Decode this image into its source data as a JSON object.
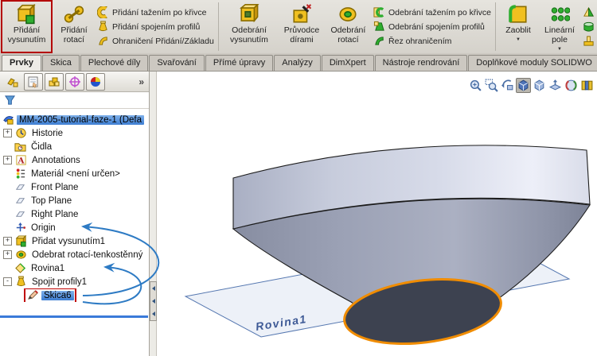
{
  "ribbon": {
    "caret_glyph": "▼",
    "groups": [
      {
        "large_buttons": [
          {
            "label": "Přidání vysunutím",
            "icon": "boss-extrude-icon",
            "highlighted": true
          },
          {
            "label": "Přidání rotací",
            "icon": "revolved-boss-icon"
          }
        ],
        "small_items": [
          {
            "label": "Přidání tažením po křivce",
            "icon": "swept-boss-icon"
          },
          {
            "label": "Přidání spojením profilů",
            "icon": "lofted-boss-icon"
          },
          {
            "label": "Ohraničení Přidání/Základu",
            "icon": "boundary-boss-icon"
          }
        ]
      },
      {
        "large_buttons": [
          {
            "label": "Odebrání vysunutím",
            "icon": "extruded-cut-icon"
          },
          {
            "label": "Průvodce dírami",
            "icon": "hole-wizard-icon"
          },
          {
            "label": "Odebrání rotací",
            "icon": "revolved-cut-icon"
          }
        ],
        "small_items": [
          {
            "label": "Odebrání tažením po křivce",
            "icon": "swept-cut-icon"
          },
          {
            "label": "Odebrání spojením profilů",
            "icon": "lofted-cut-icon"
          },
          {
            "label": "Řez ohraničením",
            "icon": "boundary-cut-icon"
          }
        ]
      },
      {
        "large_buttons": [
          {
            "label": "Zaoblit",
            "icon": "fillet-icon",
            "dropdown": true
          },
          {
            "label": "Lineární pole",
            "icon": "linear-pattern-icon",
            "dropdown": true
          }
        ],
        "small_items": [
          {
            "label": "",
            "icon": "draft-icon"
          },
          {
            "label": "",
            "icon": "shell-icon"
          },
          {
            "label": "",
            "icon": "rib-icon"
          }
        ]
      }
    ]
  },
  "tabs": {
    "items": [
      {
        "label": "Prvky",
        "active": true
      },
      {
        "label": "Skica"
      },
      {
        "label": "Plechové díly"
      },
      {
        "label": "Svařování"
      },
      {
        "label": "Přímé úpravy"
      },
      {
        "label": "Analýzy"
      },
      {
        "label": "DimXpert"
      },
      {
        "label": "Nástroje rendrování"
      },
      {
        "label": "Doplňkové moduly SOLIDWO"
      }
    ]
  },
  "feature_panel": {
    "toolbar": [
      {
        "icon": "feature-tree-icon"
      },
      {
        "icon": "property-manager-icon"
      },
      {
        "icon": "configuration-manager-icon"
      },
      {
        "icon": "dimxpert-manager-icon"
      },
      {
        "icon": "display-manager-icon"
      }
    ],
    "overflow_label": "»",
    "filter_icon": "filter-funnel-icon",
    "tree": [
      {
        "label": "MM-2005-tutorial-faze-1  (Defa",
        "icon": "part-icon",
        "level": 0,
        "selected": true
      },
      {
        "label": "Historie",
        "icon": "history-icon",
        "level": 1,
        "expander": "+"
      },
      {
        "label": "Čidla",
        "icon": "sensors-icon",
        "level": 1
      },
      {
        "label": "Annotations",
        "icon": "annotations-icon",
        "level": 1,
        "expander": "+"
      },
      {
        "label": "Materiál <není určen>",
        "icon": "material-icon",
        "level": 1
      },
      {
        "label": "Front Plane",
        "icon": "plane-icon",
        "level": 1
      },
      {
        "label": "Top Plane",
        "icon": "plane-icon",
        "level": 1
      },
      {
        "label": "Right Plane",
        "icon": "plane-icon",
        "level": 1
      },
      {
        "label": "Origin",
        "icon": "origin-icon",
        "level": 1
      },
      {
        "label": "Přidat vysunutím1",
        "icon": "boss-extrude-icon",
        "level": 1,
        "expander": "+"
      },
      {
        "label": "Odebrat rotací-tenkostěnný",
        "icon": "revolved-cut-icon",
        "level": 1,
        "expander": "+"
      },
      {
        "label": "Rovina1",
        "icon": "ref-plane-icon",
        "level": 1
      },
      {
        "label": "Spojit profily1",
        "icon": "loft-icon",
        "level": 1,
        "expander": "-"
      },
      {
        "label": "Skica6",
        "icon": "sketch-icon",
        "level": 2,
        "selected": true,
        "red_box": true
      }
    ]
  },
  "viewport": {
    "headsup": [
      {
        "icon": "zoom-fit-icon"
      },
      {
        "icon": "zoom-area-icon"
      },
      {
        "icon": "previous-view-icon"
      },
      {
        "icon": "view-orientation-icon",
        "pressed": true
      },
      {
        "icon": "display-style-icon"
      },
      {
        "icon": "section-view-icon"
      },
      {
        "icon": "appearance-icon"
      },
      {
        "icon": "hide-show-icon"
      }
    ],
    "plane_label": "Rovina1",
    "colors": {
      "edge_highlight": "#f08c00",
      "plane_edge": "#5577b0",
      "selection_blue": "#3d7ed2",
      "callout_arrow": "#2e7bc4",
      "red_highlight": "#b40000"
    }
  }
}
